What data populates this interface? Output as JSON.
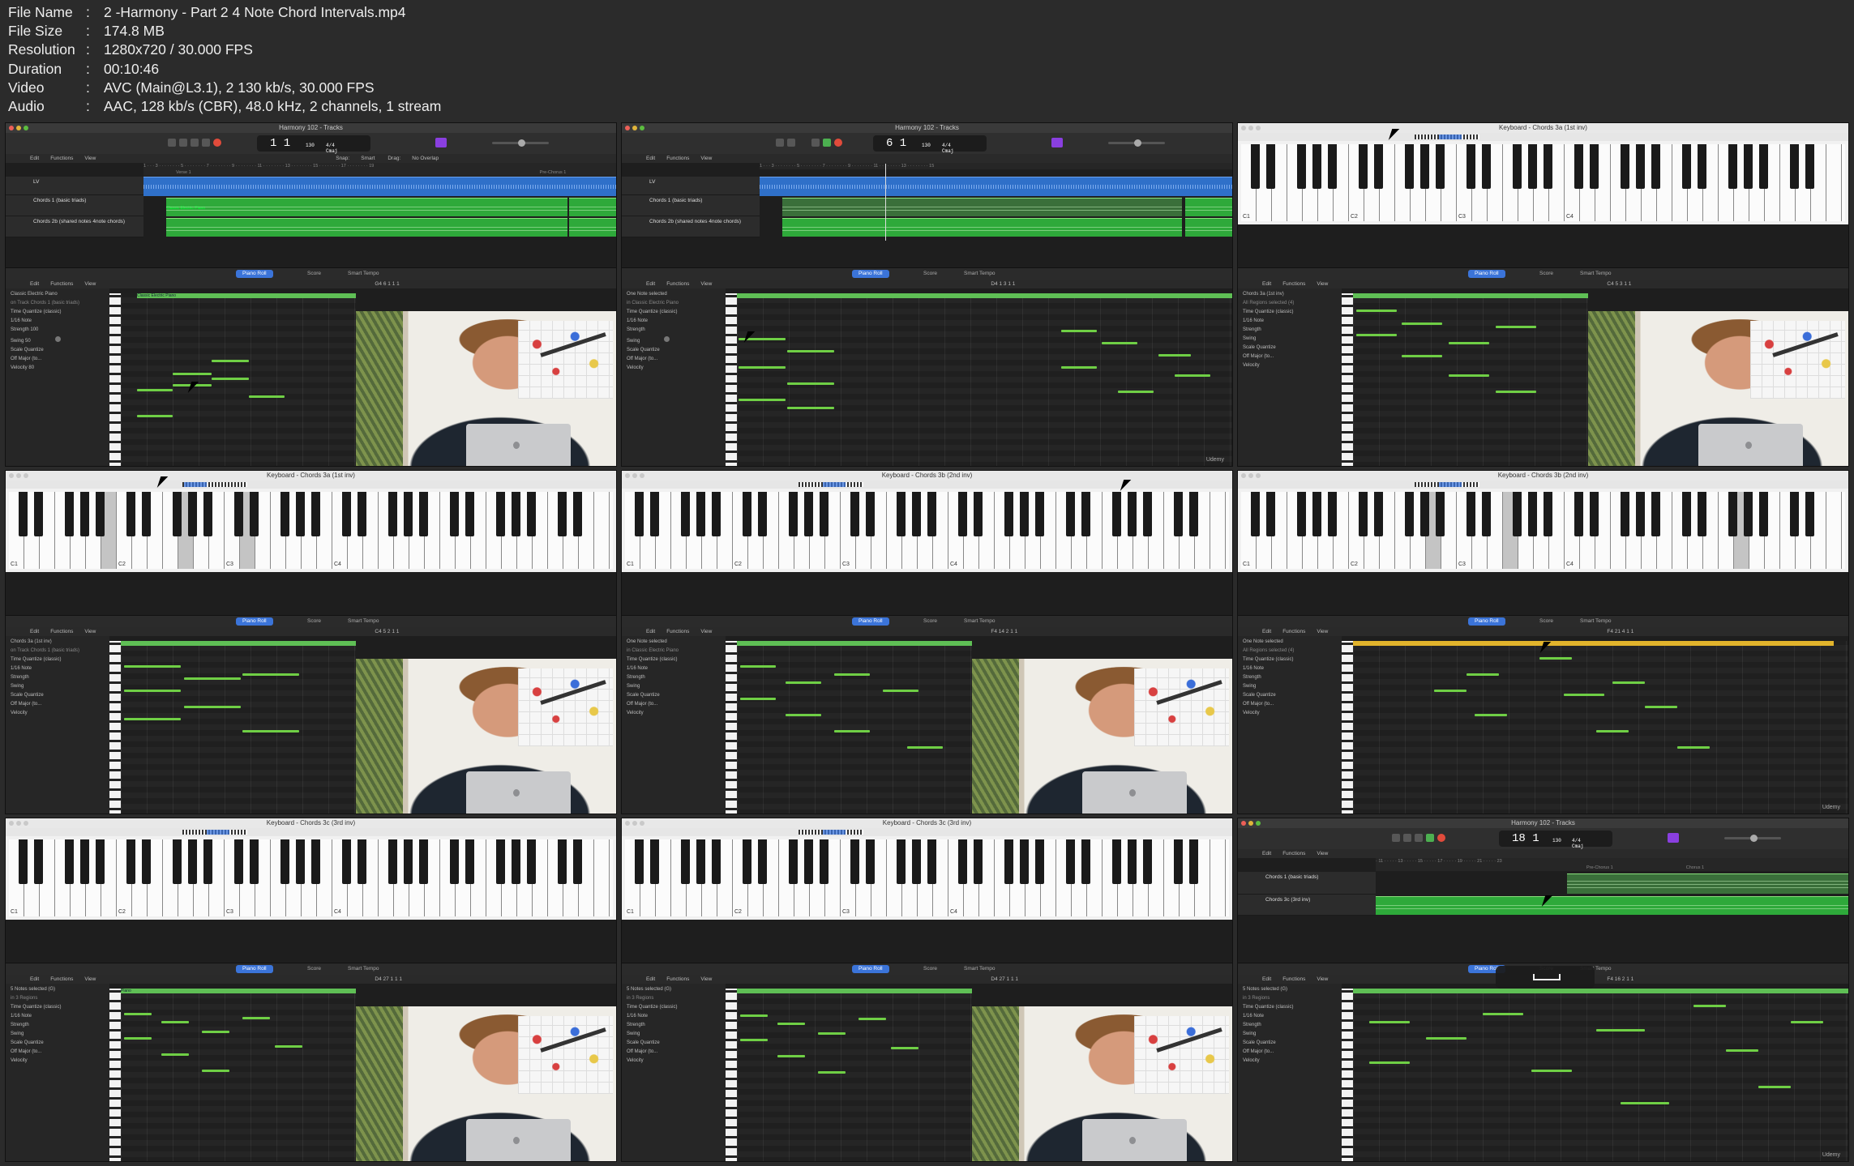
{
  "meta": {
    "rows": [
      {
        "key": "File Name",
        "value": "2 -Harmony - Part 2 4 Note Chord Intervals.mp4"
      },
      {
        "key": "File Size",
        "value": "174.8 MB"
      },
      {
        "key": "Resolution",
        "value": "1280x720 / 30.000 FPS"
      },
      {
        "key": "Duration",
        "value": "00:10:46"
      },
      {
        "key": "Video",
        "value": "AVC (Main@L3.1), 2 130 kb/s, 30.000 FPS"
      },
      {
        "key": "Audio",
        "value": "AAC, 128 kb/s (CBR), 48.0 kHz, 2 channels, 1 stream"
      }
    ]
  },
  "frames": {
    "f1": {
      "title": "Harmony 102 - Tracks",
      "lcd": "1  1",
      "tempo": "130",
      "sig": "4/4",
      "key": "Cmaj",
      "menu": [
        "Edit",
        "Functions",
        "View"
      ],
      "snap_label": "Snap:",
      "snap": "Smart",
      "drag_label": "Drag:",
      "drag": "No Overlap",
      "tracks": [
        "LV",
        "Chords 1 (basic triads)",
        "Chords 2b (shared notes 4note chords)"
      ],
      "markers": [
        "Verse 1",
        "Pre-Chorus 1"
      ],
      "region": "Classic Electric Piano",
      "tabs": [
        "Piano Roll",
        "Score",
        "Smart Tempo"
      ],
      "inspector": {
        "name": "Classic Electric Piano",
        "sub": "on Track Chords 1 (basic triads)",
        "tq": "Time Quantize (classic)",
        "note": "1/16 Note",
        "strength": "Strength",
        "strength_v": "100",
        "swing": "Swing",
        "swing_v": "50",
        "sq": "Scale Quantize",
        "off": "Off",
        "major": "Major (to...",
        "vel": "Velocity",
        "vel_v": "80"
      },
      "pos": "G4  6 1 1 1"
    },
    "f2": {
      "title": "Harmony 102 - Tracks",
      "lcd": "6  1",
      "tempo": "130",
      "sig": "4/4",
      "key": "Cmaj",
      "inspector_name": "One Note selected",
      "inspector_sub": "in Classic Electric Piano",
      "pos": "D4  1 3 1 1",
      "watermark": "Udemy"
    },
    "f3": {
      "title": "Keyboard - Chords 3a (1st inv)",
      "octaves": [
        "C1",
        "C2",
        "C3",
        "C4"
      ],
      "inspector_name": "Chords 3a (1st inv)",
      "inspector_sub": "All Regions selected (4)",
      "pos": "C4  5 3 1 1"
    },
    "f4": {
      "title": "Keyboard - Chords 3a (1st inv)",
      "octaves": [
        "C1",
        "C2",
        "C3",
        "C4"
      ],
      "inspector_name": "Chords 3a (1st inv)",
      "inspector_sub": "on Track Chords 1 (basic triads)",
      "pos": "C4  5 2 1 1"
    },
    "f5": {
      "title": "Keyboard - Chords 3b (2nd inv)",
      "octaves": [
        "C1",
        "C2",
        "C3",
        "C4"
      ],
      "inspector_name": "One Note selected",
      "inspector_sub": "in Classic Electric Piano",
      "pos": "F4  14 2 1 1"
    },
    "f6": {
      "title": "Keyboard - Chords 3b (2nd inv)",
      "octaves": [
        "C1",
        "C2",
        "C3",
        "C4"
      ],
      "inspector_name": "One Note selected",
      "inspector_sub": "All Regions selected (4)",
      "pos": "F4  21 4 1 1",
      "watermark": "Udemy"
    },
    "f7": {
      "title": "Keyboard - Chords 3c (3rd inv)",
      "octaves": [
        "C1",
        "C2",
        "C3",
        "C4"
      ],
      "inspector_name": "5 Notes selected (G)",
      "inspector_sub": "in 3 Regions",
      "pos": "D4  27 1 1 1",
      "region": "Piano"
    },
    "f8": {
      "title": "Keyboard - Chords 3c (3rd inv)",
      "octaves": [
        "C1",
        "C2",
        "C3",
        "C4"
      ],
      "inspector_name": "5 Notes selected (G)",
      "inspector_sub": "in 3 Regions",
      "pos": "D4  27 1 1 1"
    },
    "f9": {
      "title": "Harmony 102 - Tracks",
      "lcd": "18  1",
      "tempo": "130",
      "sig": "4/4",
      "key": "Cmaj",
      "tracks": [
        "Chords 1 (basic triads)",
        "Chords 3c (3rd inv)"
      ],
      "markers": [
        "Pre-Chorus 1",
        "Chorus 1"
      ],
      "inspector_name": "5 Notes selected (G)",
      "inspector_sub": "in 3 Regions",
      "pos": "F4  16 2 1 1",
      "watermark": "Udemy"
    }
  },
  "colors": {
    "accent": "#3b74d9",
    "region_green": "#2ea93a",
    "region_blue": "#2f70c9",
    "note": "#6fcf45"
  }
}
